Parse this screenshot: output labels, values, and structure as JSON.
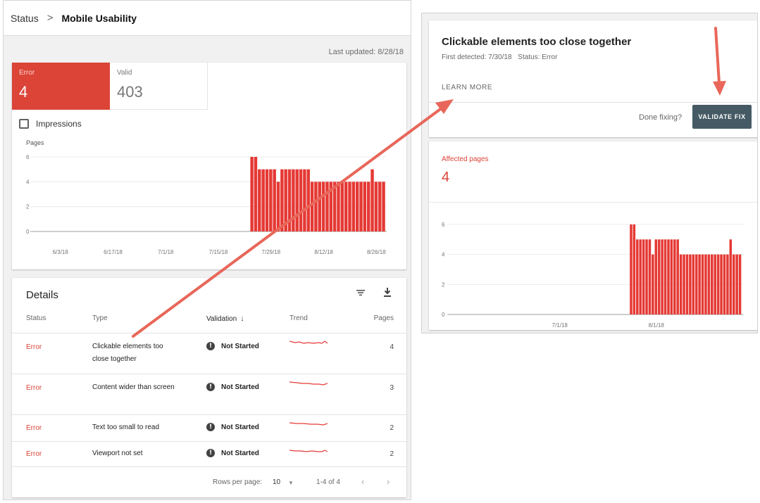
{
  "breadcrumb": {
    "parent": "Status",
    "separator": ">",
    "current": "Mobile Usability"
  },
  "last_updated": "Last updated: 8/28/18",
  "summary_tiles": [
    {
      "label": "Error",
      "value": "4",
      "color": "#db4437"
    },
    {
      "label": "Valid",
      "value": "403"
    }
  ],
  "impressions_label": "Impressions",
  "chart_data": [
    {
      "type": "bar",
      "ylabel": "Pages",
      "ylim": [
        0,
        6
      ],
      "yticks": [
        "0",
        "2",
        "4",
        "6"
      ],
      "xticks": [
        "6/3/18",
        "6/17/18",
        "7/1/18",
        "7/15/18",
        "7/29/18",
        "8/12/18",
        "8/26/18"
      ],
      "x_start": "2018-05-29",
      "x_end": "2018-08-28",
      "categories": [
        "7/24/18",
        "7/25/18",
        "7/26/18",
        "7/27/18",
        "7/28/18",
        "7/29/18",
        "7/30/18",
        "7/31/18",
        "8/1/18",
        "8/2/18",
        "8/3/18",
        "8/4/18",
        "8/5/18",
        "8/6/18",
        "8/7/18",
        "8/8/18",
        "8/9/18",
        "8/10/18",
        "8/11/18",
        "8/12/18",
        "8/13/18",
        "8/14/18",
        "8/15/18",
        "8/16/18",
        "8/17/18",
        "8/18/18",
        "8/19/18",
        "8/20/18",
        "8/21/18",
        "8/22/18",
        "8/23/18",
        "8/24/18",
        "8/25/18",
        "8/26/18",
        "8/27/18",
        "8/28/18"
      ],
      "values": [
        6,
        6,
        5,
        5,
        5,
        5,
        5,
        4,
        5,
        5,
        5,
        5,
        5,
        5,
        5,
        5,
        4,
        4,
        4,
        4,
        4,
        4,
        4,
        4,
        4,
        4,
        4,
        4,
        4,
        4,
        4,
        4,
        5,
        4,
        4,
        4
      ],
      "color": "#e53935"
    },
    {
      "type": "bar",
      "ylim": [
        0,
        6
      ],
      "yticks": [
        "0",
        "2",
        "4",
        "6"
      ],
      "xticks": [
        "7/1/18",
        "8/1/18"
      ],
      "x_start": "2018-05-29",
      "x_end": "2018-08-28",
      "categories": [
        "7/24/18",
        "7/25/18",
        "7/26/18",
        "7/27/18",
        "7/28/18",
        "7/29/18",
        "7/30/18",
        "7/31/18",
        "8/1/18",
        "8/2/18",
        "8/3/18",
        "8/4/18",
        "8/5/18",
        "8/6/18",
        "8/7/18",
        "8/8/18",
        "8/9/18",
        "8/10/18",
        "8/11/18",
        "8/12/18",
        "8/13/18",
        "8/14/18",
        "8/15/18",
        "8/16/18",
        "8/17/18",
        "8/18/18",
        "8/19/18",
        "8/20/18",
        "8/21/18",
        "8/22/18",
        "8/23/18",
        "8/24/18",
        "8/25/18",
        "8/26/18",
        "8/27/18",
        "8/28/18"
      ],
      "values": [
        6,
        6,
        5,
        5,
        5,
        5,
        5,
        4,
        5,
        5,
        5,
        5,
        5,
        5,
        5,
        5,
        4,
        4,
        4,
        4,
        4,
        4,
        4,
        4,
        4,
        4,
        4,
        4,
        4,
        4,
        4,
        4,
        5,
        4,
        4,
        4
      ],
      "color": "#e53935"
    }
  ],
  "details": {
    "title": "Details",
    "columns": {
      "status": "Status",
      "type": "Type",
      "validation": "Validation",
      "trend": "Trend",
      "pages": "Pages"
    },
    "rows": [
      {
        "status": "Error",
        "type": "Clickable elements too close together",
        "validation": "Not Started",
        "pages": "4"
      },
      {
        "status": "Error",
        "type": "Content wider than screen",
        "validation": "Not Started",
        "pages": "3"
      },
      {
        "status": "Error",
        "type": "Text too small to read",
        "validation": "Not Started",
        "pages": "2"
      },
      {
        "status": "Error",
        "type": "Viewport not set",
        "validation": "Not Started",
        "pages": "2"
      }
    ],
    "pagination": {
      "rows_per_page_label": "Rows per page:",
      "rows_per_page": "10",
      "range": "1-4 of 4"
    }
  },
  "issue": {
    "title": "Clickable elements too close together",
    "first_detected": "First detected: 7/30/18",
    "status": "Status: Error",
    "learn_more": "LEARN MORE",
    "done_fixing": "Done fixing?",
    "validate_button": "VALIDATE FIX"
  },
  "affected": {
    "label": "Affected pages",
    "value": "4"
  },
  "colors": {
    "error": "#db4437",
    "button": "#455a64",
    "annotation_arrow": "#e8675a"
  },
  "icons": [
    "filter-icon",
    "download-icon",
    "exclamation-icon",
    "sort-arrow-icon",
    "chevron-left-icon",
    "chevron-right-icon",
    "caret-down-icon"
  ]
}
